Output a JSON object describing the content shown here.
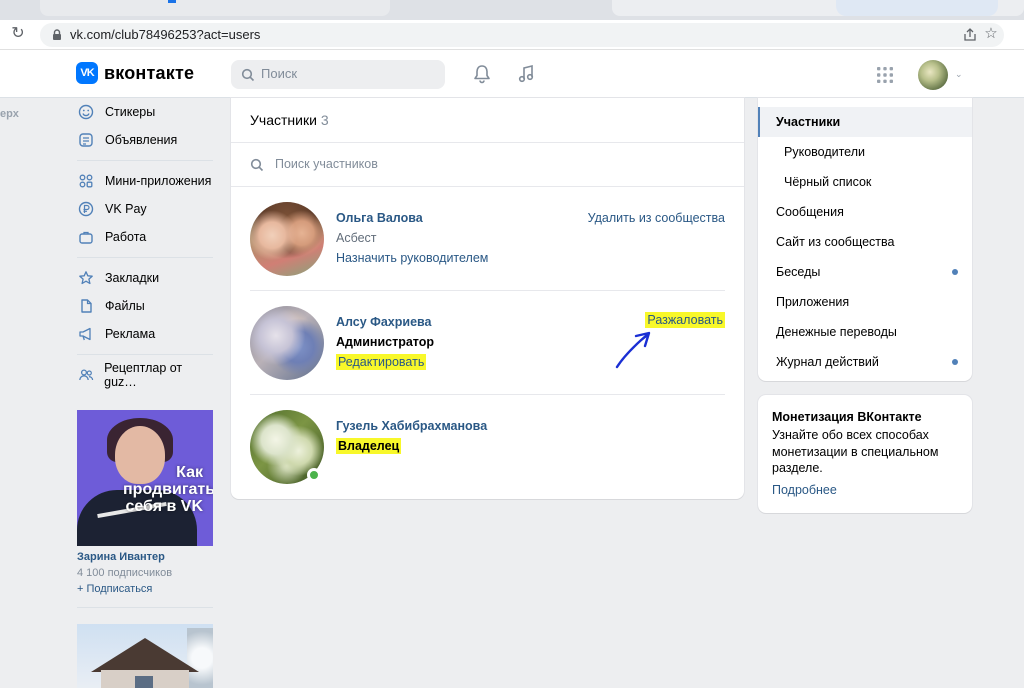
{
  "browser": {
    "url": "vk.com/club78496253?act=users"
  },
  "header": {
    "logo_text": "вконтакте",
    "logo_mark": "VK",
    "search_placeholder": "Поиск"
  },
  "left_edge_text": "ерх",
  "left_nav": {
    "group1": [
      {
        "label": "Стикеры",
        "icon": "smile-icon"
      },
      {
        "label": "Объявления",
        "icon": "ads-board-icon"
      }
    ],
    "group2": [
      {
        "label": "Мини-приложения",
        "icon": "mini-apps-icon"
      },
      {
        "label": "VK Pay",
        "icon": "vk-pay-icon"
      },
      {
        "label": "Работа",
        "icon": "briefcase-icon"
      }
    ],
    "group3": [
      {
        "label": "Закладки",
        "icon": "star-icon"
      },
      {
        "label": "Файлы",
        "icon": "file-icon"
      },
      {
        "label": "Реклама",
        "icon": "megaphone-icon"
      }
    ],
    "group4": [
      {
        "label": "Рецептлар от guz…",
        "icon": "community-icon"
      }
    ]
  },
  "promo": {
    "overlay_text": "Как продвигать себя в VK",
    "author": "Зарина Ивантер",
    "subscribers": "4 100 подписчиков",
    "follow": "+ Подписаться"
  },
  "members": {
    "title": "Участники",
    "count": "3",
    "search_placeholder": "Поиск участников",
    "list": [
      {
        "name": "Ольга Валова",
        "role": "Асбест",
        "link": "Назначить руководителем",
        "action": "Удалить из сообщества"
      },
      {
        "name": "Алсу Фахриева",
        "role": "Администратор",
        "link": "Редактировать",
        "action": "Разжаловать"
      },
      {
        "name": "Гузель Хабибрахманова",
        "role": "Владелец",
        "online": true
      }
    ]
  },
  "right_nav": {
    "items": [
      {
        "label": "Участники",
        "active": true
      },
      {
        "label": "Руководители",
        "sub": true
      },
      {
        "label": "Чёрный список",
        "sub": true
      },
      {
        "label": "Сообщения"
      },
      {
        "label": "Сайт из сообщества"
      },
      {
        "label": "Беседы",
        "dot": true
      },
      {
        "label": "Приложения"
      },
      {
        "label": "Денежные переводы"
      },
      {
        "label": "Журнал действий",
        "dot": true
      }
    ]
  },
  "monetization": {
    "title": "Монетизация ВКонтакте",
    "text": "Узнайте обо всех способах монетизации в специальном разделе.",
    "link": "Подробнее"
  },
  "colors": {
    "link": "#2a5885",
    "accent": "#5181b8",
    "highlight": "#f8f82a",
    "online": "#4bb34b",
    "annotation_arrow": "#1a2fd4"
  }
}
